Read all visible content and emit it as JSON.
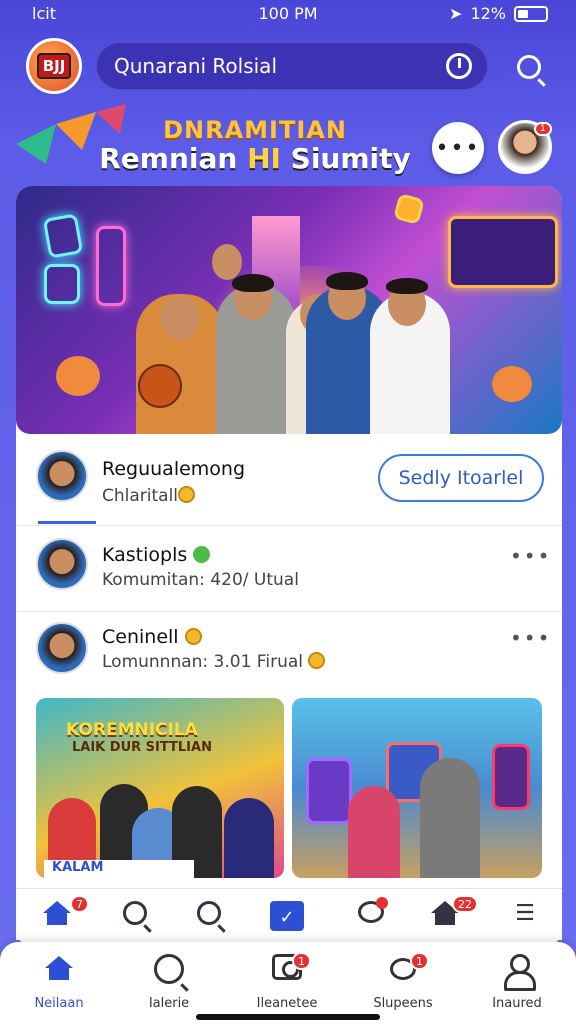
{
  "status": {
    "carrier": "lcit",
    "time": "100 PM",
    "battery": "12%"
  },
  "header": {
    "app_logo_text": "BJJ",
    "search_text": "Qunarani Rolsial"
  },
  "banner": {
    "line1": "DNRAMITIAN",
    "line2_a": "Remnian ",
    "line2_b": "HI",
    "line2_c": " Siumity",
    "avatar_badge": "1"
  },
  "profile": {
    "name": "Reguualemong",
    "subtitle": "Chlaritall",
    "follow_label": "Sedly Itoarlel"
  },
  "rows": [
    {
      "name": "Kastiopls",
      "subtitle": "Komumitan: 420/ Utual"
    },
    {
      "name": "Ceninell",
      "subtitle": "Lomunnnan: 3.01 Firual"
    }
  ],
  "thumbs": [
    {
      "title_line1": "KOREMNICILA",
      "title_line2": "LAIK DUR SITTLIAN",
      "caption": "KALAM"
    },
    {
      "title": ""
    }
  ],
  "nav_top": {
    "home_badge": "7",
    "house_badge": "22"
  },
  "nav_bottom": [
    {
      "label": "Neilaan",
      "icon": "home-icon"
    },
    {
      "label": "Ialerie",
      "icon": "search-chat-icon"
    },
    {
      "label": "Ileanetee",
      "icon": "camera-icon",
      "badge": "1"
    },
    {
      "label": "Slupeens",
      "icon": "chat-icon",
      "badge": "1"
    },
    {
      "label": "Inaured",
      "icon": "person-icon"
    }
  ],
  "colors": {
    "primary": "#4a46d8",
    "accent_blue": "#2c4fd6",
    "badge_red": "#e53030",
    "gold": "#ffc43a"
  }
}
